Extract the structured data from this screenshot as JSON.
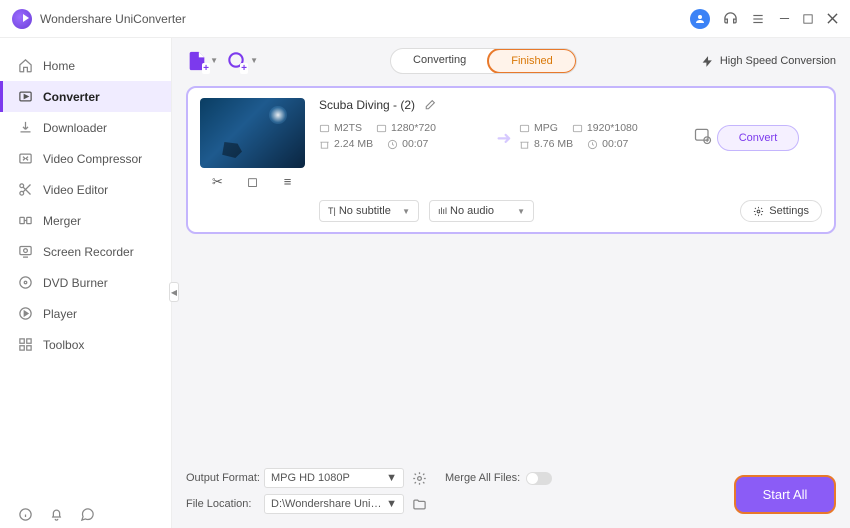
{
  "app": {
    "title": "Wondershare UniConverter"
  },
  "sidebar": {
    "items": [
      {
        "label": "Home"
      },
      {
        "label": "Converter"
      },
      {
        "label": "Downloader"
      },
      {
        "label": "Video Compressor"
      },
      {
        "label": "Video Editor"
      },
      {
        "label": "Merger"
      },
      {
        "label": "Screen Recorder"
      },
      {
        "label": "DVD Burner"
      },
      {
        "label": "Player"
      },
      {
        "label": "Toolbox"
      }
    ]
  },
  "tabs": {
    "converting": "Converting",
    "finished": "Finished"
  },
  "toolbar": {
    "hsc": "High Speed Conversion"
  },
  "card": {
    "title": "Scuba Diving - (2)",
    "src": {
      "format": "M2TS",
      "res": "1280*720",
      "size": "2.24 MB",
      "dur": "00:07"
    },
    "dst": {
      "format": "MPG",
      "res": "1920*1080",
      "size": "8.76 MB",
      "dur": "00:07"
    },
    "subtitle": "No subtitle",
    "audio": "No audio",
    "settings": "Settings",
    "convert": "Convert"
  },
  "footer": {
    "output_label": "Output Format:",
    "output_value": "MPG HD 1080P",
    "location_label": "File Location:",
    "location_value": "D:\\Wondershare UniConverter",
    "merge_label": "Merge All Files:",
    "start_all": "Start All"
  }
}
